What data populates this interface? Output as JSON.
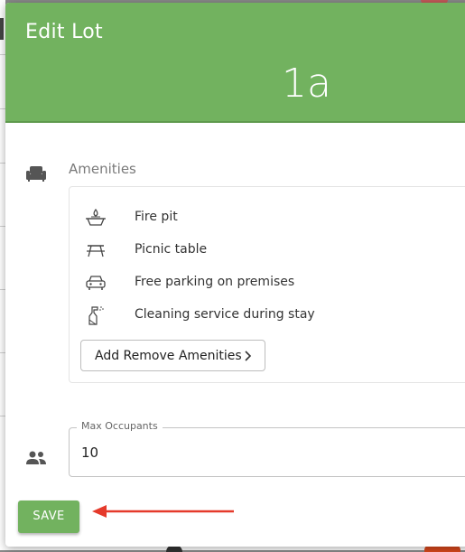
{
  "dialog": {
    "title": "Edit Lot",
    "lot_name": "1a"
  },
  "amenities": {
    "heading": "Amenities",
    "section_icon": "couch-icon",
    "items": [
      {
        "label": "Fire pit",
        "icon": "fire-pit-icon"
      },
      {
        "label": "Picnic table",
        "icon": "picnic-table-icon"
      },
      {
        "label": "Free parking on premises",
        "icon": "car-icon"
      },
      {
        "label": "Cleaning service during stay",
        "icon": "spray-bottle-icon"
      }
    ],
    "add_remove_label": "Add Remove Amenities",
    "add_remove_icon": "chevron-right-icon"
  },
  "max_occupants": {
    "label": "Max Occupants",
    "value": "10",
    "icon": "people-icon"
  },
  "save_label": "SAVE",
  "colors": {
    "header": "#72b25f",
    "save_button": "#72b25f",
    "annotation_arrow": "#e53a2b"
  }
}
